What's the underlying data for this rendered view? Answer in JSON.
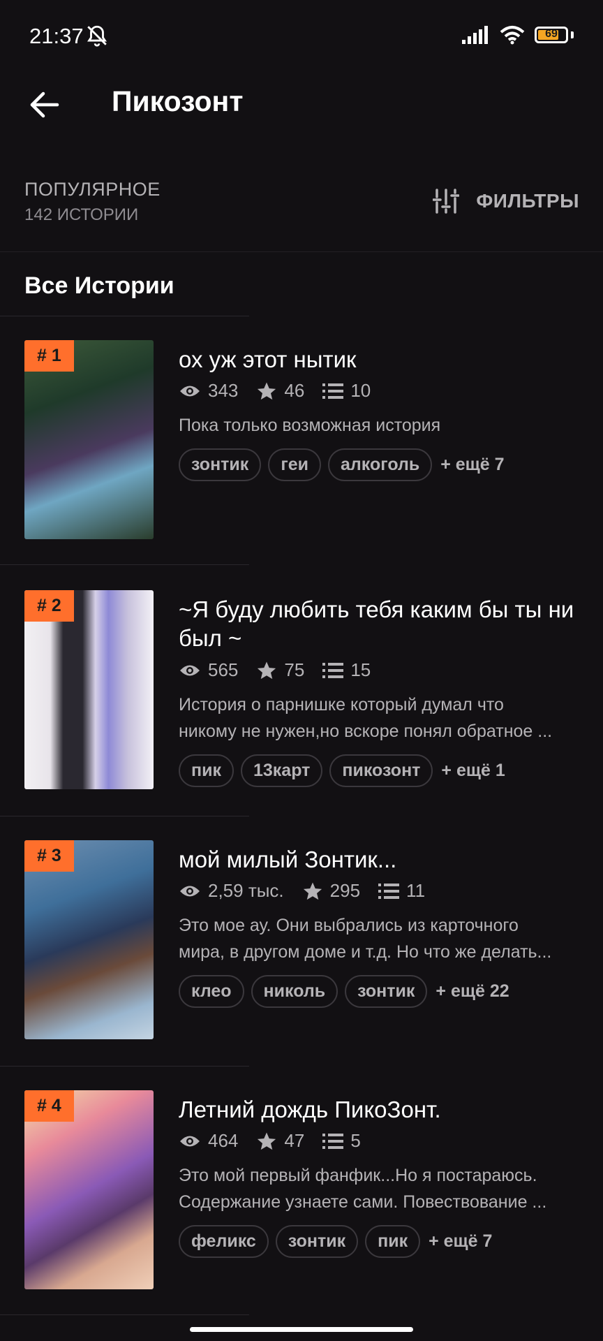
{
  "status": {
    "time": "21:37",
    "battery": "69"
  },
  "header": {
    "title": "Пикозонт"
  },
  "section": {
    "sort": "ПОПУЛЯРНОЕ",
    "count": "142 ИСТОРИИ",
    "filters": "ФИЛЬТРЫ"
  },
  "group_title": "Все Истории",
  "colors": {
    "accent": "#ff6f2c",
    "background": "#121013"
  },
  "stories": [
    {
      "rank": "# 1",
      "title": "ох уж этот нытик",
      "views": "343",
      "stars": "46",
      "parts": "10",
      "desc1": "Пока только возможная история",
      "desc2": "",
      "tags": [
        "зонтик",
        "геи",
        "алкоголь"
      ],
      "more": "+ ещё 7"
    },
    {
      "rank": "# 2",
      "title": "~Я буду любить тебя каким бы ты ни был ~",
      "views": "565",
      "stars": "75",
      "parts": "15",
      "desc1": "История о парнишке который думал что",
      "desc2": "никому не нужен,но вскоре понял обратное ...",
      "tags": [
        "пик",
        "13карт",
        "пикозонт"
      ],
      "more": "+ ещё 1"
    },
    {
      "rank": "# 3",
      "title": "мой милый Зонтик...",
      "views": "2,59 тыс.",
      "stars": "295",
      "parts": "11",
      "desc1": "Это мое ау. Они выбрались из карточного",
      "desc2": "мира, в другом доме и т.д. Но что же делать...",
      "tags": [
        "клео",
        "николь",
        "зонтик"
      ],
      "more": "+ ещё 22"
    },
    {
      "rank": "# 4",
      "title": "Летний дождь ПикоЗонт.",
      "views": "464",
      "stars": "47",
      "parts": "5",
      "desc1": "Это мой первый фанфик...Но я постараюсь.",
      "desc2": "Содержание узнаете сами. Повествование ...",
      "tags": [
        "феликс",
        "зонтик",
        "пик"
      ],
      "more": "+ ещё 7"
    }
  ]
}
